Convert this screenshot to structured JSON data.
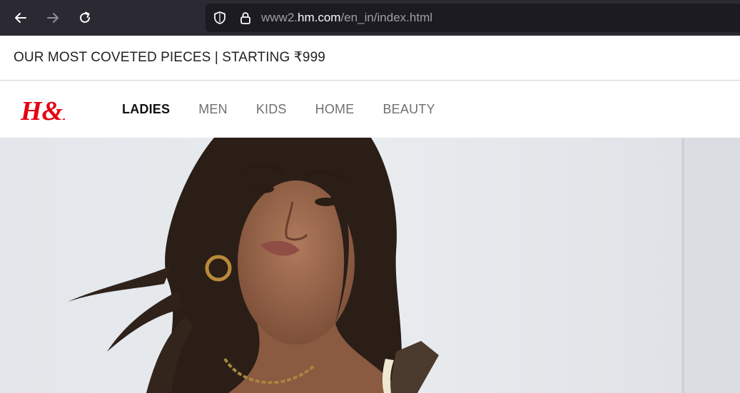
{
  "browser": {
    "back_icon": "arrow-left-icon",
    "forward_icon": "arrow-right-icon",
    "reload_icon": "reload-icon",
    "tracking_icon": "shield-icon",
    "lock_icon": "lock-icon",
    "url_prefix": "www2.",
    "url_domain": "hm.com",
    "url_path": "/en_in/index.html"
  },
  "promo": {
    "text": "OUR MOST COVETED PIECES | STARTING ₹999"
  },
  "header": {
    "logo_text": "H&M",
    "brand_color": "#e50010",
    "nav": [
      {
        "label": "LADIES",
        "active": true
      },
      {
        "label": "MEN",
        "active": false
      },
      {
        "label": "KIDS",
        "active": false
      },
      {
        "label": "HOME",
        "active": false
      },
      {
        "label": "BEAUTY",
        "active": false
      }
    ]
  },
  "hero": {
    "image": "model-portrait-photo"
  }
}
